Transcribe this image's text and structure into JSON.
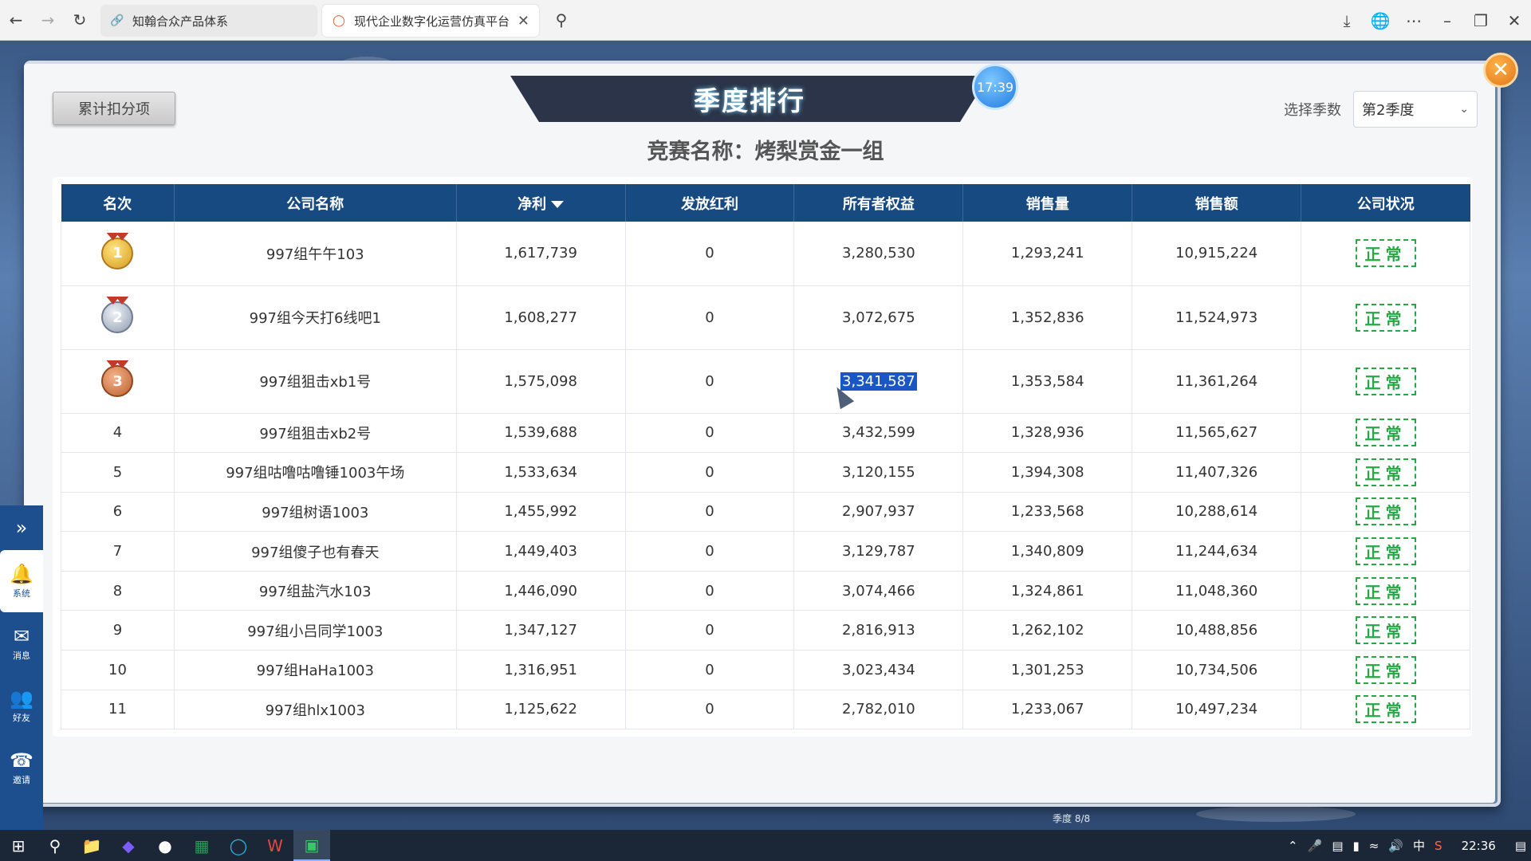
{
  "browser": {
    "tabs": [
      {
        "title": "知翰合众产品体系",
        "icon": "link-icon",
        "active": false
      },
      {
        "title": "现代企业数字化运营仿真平台",
        "icon": "loading-icon",
        "active": true
      }
    ]
  },
  "panel": {
    "title": "季度排行",
    "timer": "17:39",
    "deduct_button": "累计扣分项",
    "season_label": "选择季数",
    "season_value": "第2季度",
    "competition": "竞赛名称：烤梨赏金一组"
  },
  "table": {
    "headers": [
      "名次",
      "公司名称",
      "净利",
      "发放红利",
      "所有者权益",
      "销售量",
      "销售额",
      "公司状况"
    ],
    "sorted_column": "净利",
    "rows": [
      {
        "rank": "1",
        "company": "997组午午103",
        "profit": "1,617,739",
        "dividend": "0",
        "equity": "3,280,530",
        "sales_qty": "1,293,241",
        "sales_amt": "10,915,224",
        "status": "正常"
      },
      {
        "rank": "2",
        "company": "997组今天打6线吧1",
        "profit": "1,608,277",
        "dividend": "0",
        "equity": "3,072,675",
        "sales_qty": "1,352,836",
        "sales_amt": "11,524,973",
        "status": "正常"
      },
      {
        "rank": "3",
        "company": "997组狙击xb1号",
        "profit": "1,575,098",
        "dividend": "0",
        "equity": "3,341,587",
        "sales_qty": "1,353,584",
        "sales_amt": "11,361,264",
        "status": "正常"
      },
      {
        "rank": "4",
        "company": "997组狙击xb2号",
        "profit": "1,539,688",
        "dividend": "0",
        "equity": "3,432,599",
        "sales_qty": "1,328,936",
        "sales_amt": "11,565,627",
        "status": "正常"
      },
      {
        "rank": "5",
        "company": "997组咕噜咕噜锤1003午场",
        "profit": "1,533,634",
        "dividend": "0",
        "equity": "3,120,155",
        "sales_qty": "1,394,308",
        "sales_amt": "11,407,326",
        "status": "正常"
      },
      {
        "rank": "6",
        "company": "997组树语1003",
        "profit": "1,455,992",
        "dividend": "0",
        "equity": "2,907,937",
        "sales_qty": "1,233,568",
        "sales_amt": "10,288,614",
        "status": "正常"
      },
      {
        "rank": "7",
        "company": "997组傻子也有春天",
        "profit": "1,449,403",
        "dividend": "0",
        "equity": "3,129,787",
        "sales_qty": "1,340,809",
        "sales_amt": "11,244,634",
        "status": "正常"
      },
      {
        "rank": "8",
        "company": "997组盐汽水103",
        "profit": "1,446,090",
        "dividend": "0",
        "equity": "3,074,466",
        "sales_qty": "1,324,861",
        "sales_amt": "11,048,360",
        "status": "正常"
      },
      {
        "rank": "9",
        "company": "997组小吕同学1003",
        "profit": "1,347,127",
        "dividend": "0",
        "equity": "2,816,913",
        "sales_qty": "1,262,102",
        "sales_amt": "10,488,856",
        "status": "正常"
      },
      {
        "rank": "10",
        "company": "997组HaHa1003",
        "profit": "1,316,951",
        "dividend": "0",
        "equity": "3,023,434",
        "sales_qty": "1,301,253",
        "sales_amt": "10,734,506",
        "status": "正常"
      },
      {
        "rank": "11",
        "company": "997组hlx1003",
        "profit": "1,125,622",
        "dividend": "0",
        "equity": "2,782,010",
        "sales_qty": "1,233,067",
        "sales_amt": "10,497,234",
        "status": "正常"
      }
    ]
  },
  "sidebar": {
    "items": [
      {
        "label": "系统",
        "icon": "bell-icon"
      },
      {
        "label": "消息",
        "icon": "message-icon"
      },
      {
        "label": "好友",
        "icon": "friends-icon"
      },
      {
        "label": "邀请",
        "icon": "invite-icon"
      }
    ]
  },
  "footer": {
    "season_progress": "季度 8/8"
  },
  "taskbar": {
    "clock": "22:36",
    "ime": "中"
  },
  "colors": {
    "header_bg": "#164a80",
    "status_green": "#28a745",
    "banner_bg": "#2b3448",
    "sidebar_bg": "#1d4f8e"
  }
}
